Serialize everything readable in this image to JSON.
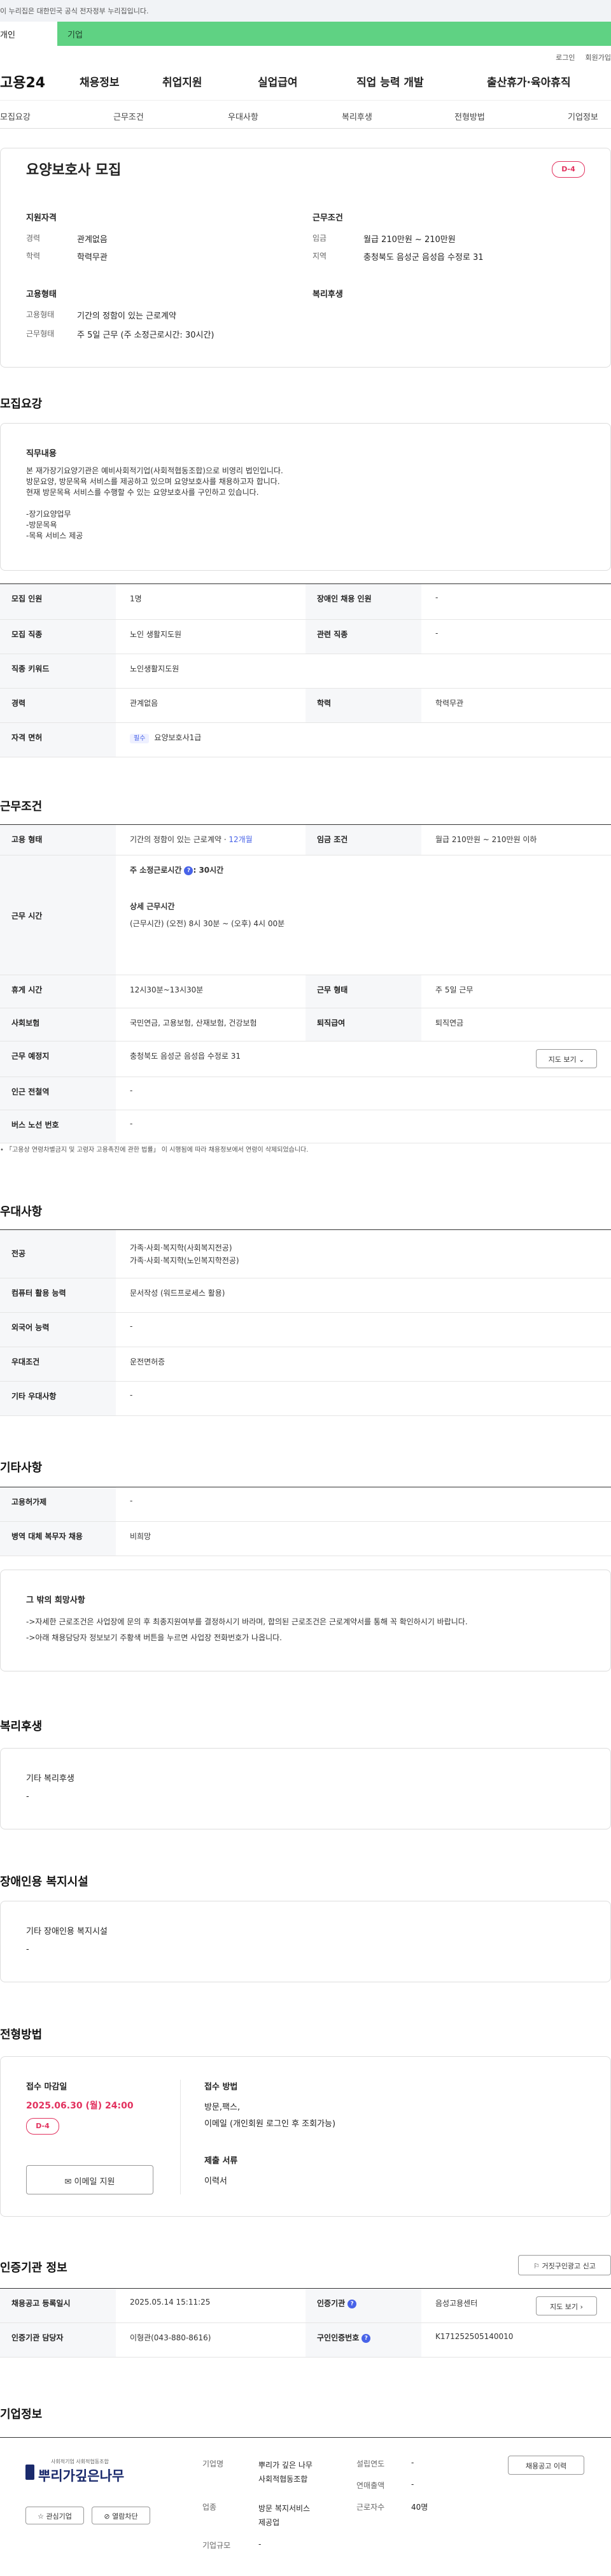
{
  "gov_banner": "이 누리집은 대한민국 공식 전자정부 누리집입니다.",
  "top_tabs": {
    "individual": "개인",
    "business": "기업"
  },
  "util": {
    "login": "로그인",
    "signup": "회원가입"
  },
  "gnb": {
    "logo": "고용24",
    "items": [
      "채용정보",
      "취업지원",
      "실업급여",
      "직업 능력 개발",
      "출산휴가·육아휴직"
    ]
  },
  "lnb": [
    "모집요강",
    "근무조건",
    "우대사항",
    "복리후생",
    "전형방법",
    "기업정보"
  ],
  "summary": {
    "title": "요양보호사 모집",
    "dday": "D-4",
    "qual_h": "지원자격",
    "career_l": "경력",
    "career_v": "관계없음",
    "edu_l": "학력",
    "edu_v": "학력무관",
    "cond_h": "근무조건",
    "wage_l": "임금",
    "wage_v": "월급 210만원 ~ 210만원",
    "area_l": "지역",
    "area_v": "충청북도 음성군 음성읍 수정로 31",
    "emp_h": "고용형태",
    "type_l": "고용형태",
    "type_v": "기간의 정함이 있는 근로계약",
    "work_l": "근무형태",
    "work_v": "주 5일 근무 (주 소정근로시간: 30시간)",
    "welfare_h": "복리후생"
  },
  "recruit": {
    "heading": "모집요강",
    "duty_h": "직무내용",
    "duty_lines": [
      "본 재가장기요양기관은 예비사회적기업(사회적협동조합)으로 비영리 법인입니다.",
      "방문요양, 방문목욕 서비스를 제공하고 있으며 요양보호사를 채용하고자 합니다.",
      "현재 방문목욕 서비스를 수행할 수 있는 요양보호사를 구인하고 있습니다.",
      "",
      "-장기요양업무",
      "-방문목욕",
      "-목욕 서비스 제공"
    ],
    "rows": [
      {
        "l1": "모집 인원",
        "v1": "1명",
        "l2": "장애인 채용 인원",
        "v2": "-"
      },
      {
        "l1": "모집 직종",
        "v1": "노인 생활지도원",
        "l2": "관련 직종",
        "v2": "-"
      },
      {
        "l1": "직종 키워드",
        "v1": "노인생활지도원"
      },
      {
        "l1": "경력",
        "v1": "관계없음",
        "l2": "학력",
        "v2": "학력무관"
      },
      {
        "l1": "자격 면허",
        "tag": "필수",
        "v1": "요양보호사1급"
      }
    ]
  },
  "condition": {
    "heading": "근무조건",
    "emp_l": "고용 형태",
    "emp_v": "기간의 정함이 있는 근로계약 · ",
    "emp_month": "12개월",
    "wage_l": "임금 조건",
    "wage_v": "월급 210만원 ~ 210만원 이하",
    "time_l": "근무 시간",
    "time_main": "주 소정근로시간",
    "time_main_v": ": 30시간",
    "time_detail_h": "상세 근무시간",
    "time_detail_v": "(근무시간) (오전) 8시 30분 ~ (오후) 4시 00분",
    "break_l": "휴게 시간",
    "break_v": "12시30분~13시30분",
    "form_l": "근무 형태",
    "form_v": "주 5일 근무",
    "ins_l": "사회보험",
    "ins_v": "국민연금, 고용보험, 산재보험, 건강보험",
    "ret_l": "퇴직급여",
    "ret_v": "퇴직연금",
    "place_l": "근무 예정지",
    "place_v": "충청북도 음성군 음성읍 수정로 31",
    "map_btn": "지도 보기",
    "subway_l": "인근 전철역",
    "subway_v": "-",
    "bus_l": "버스 노선 번호",
    "bus_v": "-",
    "note": "• 「고용상 연령차별금지 및 고령자 고용촉진에 관한 법률」 이 시행됨에 따라 채용정보에서 연령이 삭제되었습니다."
  },
  "pref": {
    "heading": "우대사항",
    "major_l": "전공",
    "major_v1": "가족·사회·복지학(사회복지전공)",
    "major_v2": "가족·사회·복지학(노인복지학전공)",
    "pc_l": "컴퓨터 활용 능력",
    "pc_v": "문서작성 (워드프로세스 활용)",
    "lang_l": "외국어 능력",
    "lang_v": "-",
    "cond_l": "우대조건",
    "cond_v": "운전면허증",
    "etc_l": "기타 우대사항",
    "etc_v": "-"
  },
  "other": {
    "heading": "기타사항",
    "permit_l": "고용허가제",
    "permit_v": "-",
    "mil_l": "병역 대체 복무자 채용",
    "mil_v": "비희망",
    "wish_h": "그 밖의 희망사항",
    "wish_1": "->자세한 근로조건은 사업장에 문의 후 최종지원여부를 결정하시기 바라며, 합의된 근로조건은 근로계약서를 통해 꼭 확인하시기 바랍니다.",
    "wish_2": "->아래 채용담당자 정보보기 주황색 버튼을 누르면 사업장 전화번호가 나옵니다."
  },
  "welfare": {
    "heading": "복리후생",
    "sub": "기타 복리후생",
    "val": "-"
  },
  "disabled": {
    "heading": "장애인용 복지시설",
    "sub": "기타 장애인용 복지시설",
    "val": "-"
  },
  "process": {
    "heading": "전형방법",
    "deadline_h": "접수 마감일",
    "deadline_v": "2025.06.30 (월) 24:00",
    "dday": "D-4",
    "email_btn": "이메일 지원",
    "method_h": "접수 방법",
    "method_1": "방문,팩스,",
    "method_2": "이메일 (개인회원 로그인 후 조회가능)",
    "docs_h": "제출 서류",
    "docs_v": "이력서"
  },
  "agency": {
    "heading": "인증기관 정보",
    "report_btn": "거짓구인광고 신고",
    "reg_l": "채용공고 등록일시",
    "reg_v": "2025.05.14 15:11:25",
    "inst_l": "인증기관",
    "inst_v": "음성고용센터",
    "map_btn": "지도 보기",
    "mgr_l": "인증기관 담당자",
    "mgr_v": "이형관(043-880-8616)",
    "no_l": "구인인증번호",
    "no_v": "K171252505140010"
  },
  "company": {
    "heading": "기업정보",
    "logo_small": "사회적기업 사회적협동조합",
    "logo_big": "뿌리가깊은나무",
    "fav_btn": "관심기업",
    "block_btn": "열람차단",
    "name_l": "기업명",
    "name_v1": "뿌리가 깊은 나무",
    "name_v2": "사회적협동조합",
    "ind_l": "업종",
    "ind_v1": "방문 복지서비스",
    "ind_v2": "제공업",
    "size_l": "기업규모",
    "size_v": "-",
    "est_l": "설립연도",
    "est_v": "-",
    "sales_l": "연매출액",
    "sales_v": "-",
    "emp_l": "근로자수",
    "emp_v": "40명",
    "history_btn": "채용공고 이력"
  }
}
